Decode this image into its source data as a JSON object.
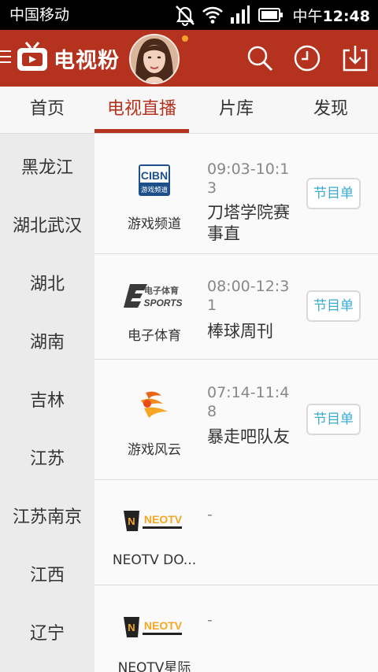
{
  "status_bar": {
    "carrier": "中国移动",
    "time_prefix": "中午",
    "time": "12:48",
    "icons": [
      "mute-icon",
      "wifi-icon",
      "signal-icon",
      "battery-icon"
    ]
  },
  "header": {
    "logo_text": "电视粉",
    "icons": [
      "menu-icon",
      "search-icon",
      "history-icon",
      "download-icon"
    ],
    "accent_color": "#b5321e"
  },
  "tabs": [
    {
      "label": "首页",
      "active": false
    },
    {
      "label": "电视直播",
      "active": true
    },
    {
      "label": "片库",
      "active": false
    },
    {
      "label": "发现",
      "active": false
    }
  ],
  "regions": [
    "黑龙江",
    "湖北武汉",
    "湖北",
    "湖南",
    "吉林",
    "江苏",
    "江苏南京",
    "江西",
    "辽宁"
  ],
  "channels": [
    {
      "name": "游戏频道",
      "logo": "cibn-logo",
      "logo_text": "CIBN",
      "logo_sub": "游戏频道",
      "time": "09:03-10:13",
      "program": "刀塔学院赛事直",
      "button": "节目单"
    },
    {
      "name": "电子体育",
      "logo": "esports-logo",
      "logo_text": "电子体育",
      "logo_sub": "SPORTS",
      "time": "08:00-12:31",
      "program": "棒球周刊",
      "button": "节目单"
    },
    {
      "name": "游戏风云",
      "logo": "gamefy-logo",
      "time": "07:14-11:48",
      "program": "暴走吧队友",
      "button": "节目单"
    },
    {
      "name": "NEOTV DO...",
      "logo": "neotv-logo",
      "logo_text": "NEOTV",
      "time": "-",
      "program": ""
    },
    {
      "name": "NEOTV星际",
      "logo": "neotv-logo",
      "logo_text": "NEOTV",
      "time": "-",
      "program": ""
    }
  ]
}
